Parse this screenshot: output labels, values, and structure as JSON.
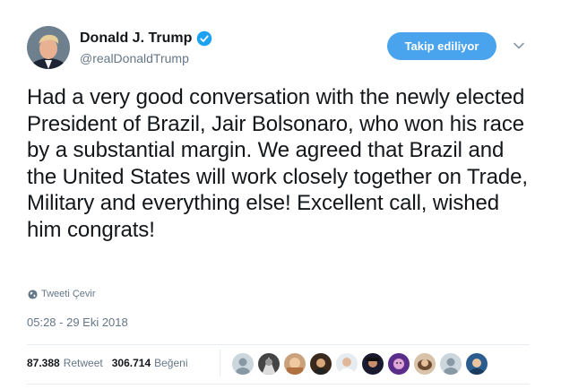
{
  "author": {
    "display_name": "Donald J. Trump",
    "handle": "@realDonaldTrump"
  },
  "follow_button_label": "Takip ediliyor",
  "tweet": {
    "text": "Had a very good conversation with the newly elected President of Brazil, Jair Bolsonaro, who won his race by a substantial margin. We agreed that Brazil and the United States will work closely together on Trade, Military and everything else! Excellent call, wished him congrats!",
    "translate_label": "Tweeti Çevir",
    "timestamp": "05:28 - 29 Eki 2018"
  },
  "stats": {
    "retweet_count": "87.388",
    "retweet_label": "Retweet",
    "like_count": "306.714",
    "like_label": "Beğeni"
  },
  "colors": {
    "follow_button": "#4aa3ed",
    "verified_badge": "#1da1f2",
    "secondary_text": "#657786",
    "divider": "#e6ecf0"
  },
  "icons": [
    "verified-badge-icon",
    "chevron-down-icon",
    "globe-icon"
  ]
}
